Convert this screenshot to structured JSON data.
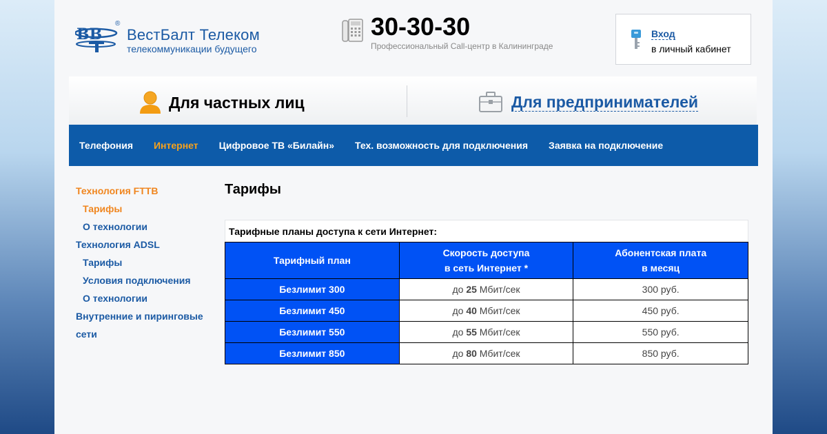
{
  "header": {
    "logo_name": "ВестБалт Телеком",
    "logo_tagline": "телекоммуникации будущего",
    "logo_reg": "®",
    "phone_number": "30-30-30",
    "phone_subtitle": "Профессиональный Call-центр в Калининграде",
    "login_link": "Вход",
    "login_subtitle": "в личный кабинет"
  },
  "segments": {
    "private_label": "Для частных лиц",
    "business_label": "Для предпринимателей"
  },
  "nav": {
    "items": [
      {
        "label": "Телефония",
        "active": false
      },
      {
        "label": "Интернет",
        "active": true
      },
      {
        "label": "Цифровое ТВ «Билайн»",
        "active": false
      },
      {
        "label": "Тех. возможность для подключения",
        "active": false
      },
      {
        "label": "Заявка на подключение",
        "active": false
      }
    ]
  },
  "sidebar": {
    "items": [
      {
        "label": "Технология FTTB",
        "sub": false,
        "active": true
      },
      {
        "label": "Тарифы",
        "sub": true,
        "active": true
      },
      {
        "label": "О технологии",
        "sub": true,
        "active": false
      },
      {
        "label": "Технология ADSL",
        "sub": false,
        "active": false
      },
      {
        "label": "Тарифы",
        "sub": true,
        "active": false
      },
      {
        "label": "Условия подключения",
        "sub": true,
        "active": false
      },
      {
        "label": "О технологии",
        "sub": true,
        "active": false
      },
      {
        "label": "Внутренние и пиринговые",
        "sub": false,
        "active": false
      },
      {
        "label": "сети",
        "sub": false,
        "active": false
      }
    ]
  },
  "content": {
    "title": "Тарифы",
    "caption": "Тарифные планы доступа к сети Интернет:",
    "table": {
      "headers": {
        "plan": "Тарифный план",
        "speed_line1": "Скорость доступа",
        "speed_line2": "в сеть Интернет *",
        "fee_line1": "Абонентская плата",
        "fee_line2": "в месяц"
      },
      "rows": [
        {
          "plan": "Безлимит 300",
          "speed_prefix": "до",
          "speed_value": "25",
          "speed_unit": "Мбит/сек",
          "fee": "300 руб."
        },
        {
          "plan": "Безлимит 450",
          "speed_prefix": "до",
          "speed_value": "40",
          "speed_unit": "Мбит/сек",
          "fee": "450 руб."
        },
        {
          "plan": "Безлимит 550",
          "speed_prefix": "до",
          "speed_value": "55",
          "speed_unit": "Мбит/сек",
          "fee": "550 руб."
        },
        {
          "plan": "Безлимит 850",
          "speed_prefix": "до",
          "speed_value": "80",
          "speed_unit": "Мбит/сек",
          "fee": "850 руб."
        }
      ]
    }
  },
  "colors": {
    "brand_blue": "#1b5aa4",
    "nav_blue": "#0d5ba9",
    "accent_orange": "#f0861f",
    "table_blue": "#0052f5"
  },
  "icons": {
    "logo": "vbt-logo-icon",
    "phone": "desk-phone-icon",
    "key": "key-icon",
    "person": "person-icon",
    "briefcase": "briefcase-icon"
  }
}
